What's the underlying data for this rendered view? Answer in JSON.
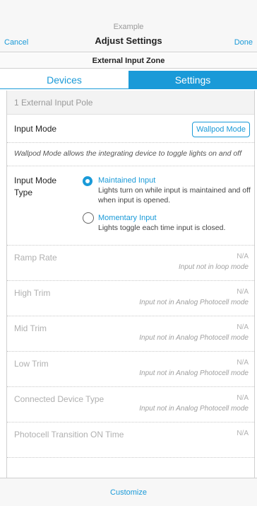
{
  "header": {
    "subtitle": "Example",
    "title": "Adjust Settings",
    "cancel_label": "Cancel",
    "done_label": "Done"
  },
  "zone_title": "External Input Zone",
  "tabs": [
    {
      "label": "Devices",
      "active": false
    },
    {
      "label": "Settings",
      "active": true
    }
  ],
  "pole_title": "1 External Input Pole",
  "input_mode": {
    "label": "Input Mode",
    "value": "Wallpod Mode",
    "description": "Wallpod Mode allows the integrating device to toggle lights on and off"
  },
  "mode_type": {
    "label": "Input Mode Type",
    "options": [
      {
        "title": "Maintained Input",
        "description": "Lights turn on while input is maintained and off when input is opened.",
        "selected": true
      },
      {
        "title": "Momentary Input",
        "description": "Lights toggle each time input is closed.",
        "selected": false
      }
    ]
  },
  "disabled_settings": [
    {
      "label": "Ramp Rate",
      "value": "N/A",
      "note": "Input not in loop mode"
    },
    {
      "label": "High Trim",
      "value": "N/A",
      "note": "Input not in Analog Photocell mode"
    },
    {
      "label": "Mid Trim",
      "value": "N/A",
      "note": "Input not in Analog Photocell mode"
    },
    {
      "label": "Low Trim",
      "value": "N/A",
      "note": "Input not in Analog Photocell mode"
    },
    {
      "label": "Connected Device Type",
      "value": "N/A",
      "note": "Input not in Analog Photocell mode"
    },
    {
      "label": "Photocell Transition ON Time",
      "value": "N/A",
      "note": ""
    }
  ],
  "footer": {
    "customize_label": "Customize"
  },
  "colors": {
    "accent": "#1a9ad8",
    "disabled_text": "#b0b0b0"
  }
}
